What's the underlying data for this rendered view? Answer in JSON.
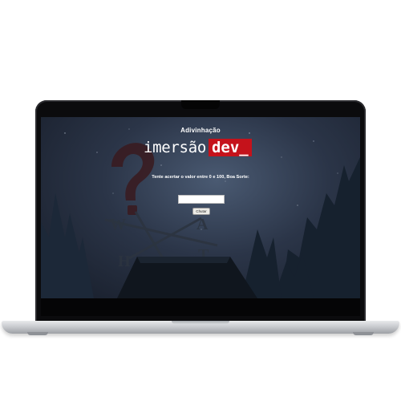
{
  "page": {
    "title": "Adivinhação",
    "logo": {
      "word": "imersão",
      "box_text": "dev_",
      "box_color": "#c5121b"
    },
    "instruction": "Tente acertar o valor entre 0 e 100, Boa Sorte:",
    "guess_input": {
      "value": "",
      "placeholder": ""
    },
    "submit_label": "Chutar"
  },
  "background": {
    "description_icon": "weathervane-question-mark-illustration",
    "sky_color": "#2b3548",
    "tree_color": "#14202a"
  }
}
